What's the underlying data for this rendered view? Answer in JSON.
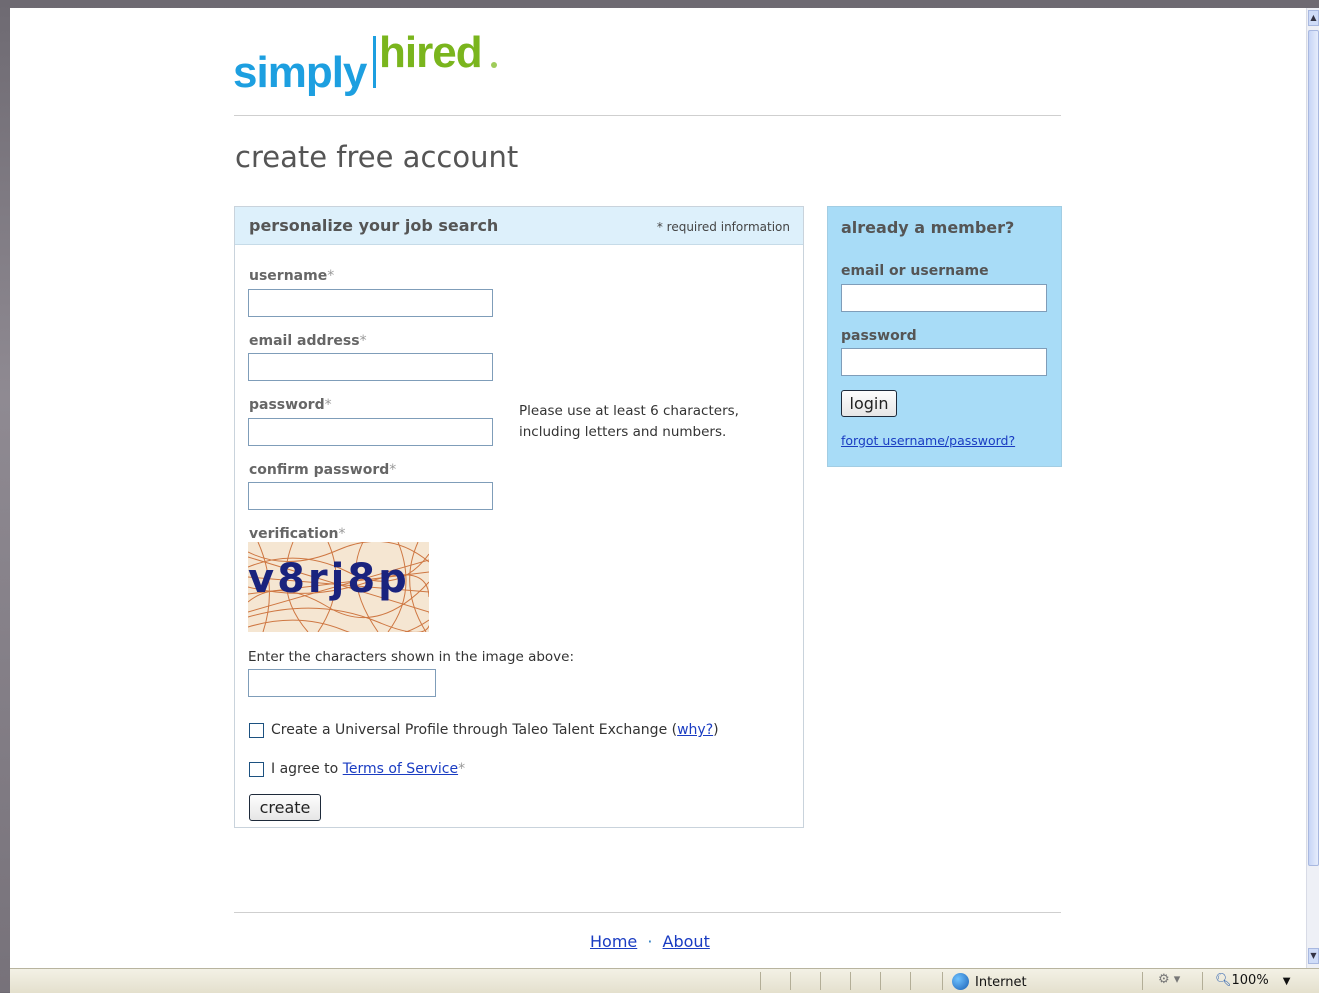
{
  "logo": {
    "part1": "simply",
    "part2": "hired"
  },
  "page_title": "create free account",
  "form": {
    "header_title": "personalize your job search",
    "required_note": "* required information",
    "fields": {
      "username": "username",
      "email": "email address",
      "password": "password",
      "confirm_password": "confirm password",
      "verification": "verification"
    },
    "required_star": "*",
    "password_hint_line1": "Please use at least 6 characters,",
    "password_hint_line2": "including letters and numbers.",
    "captcha_chars": "v8rj8p",
    "captcha_instruction": "Enter the characters shown in the image above:",
    "universal_profile_label": "Create a Universal Profile through Taleo Talent Exchange (",
    "universal_profile_link": "why?",
    "universal_profile_close": ")",
    "agree_label": "I agree to ",
    "terms_link": "Terms of Service",
    "agree_star": "*",
    "create_button": "create"
  },
  "login": {
    "title": "already a member?",
    "user_label": "email or username",
    "password_label": "password",
    "login_button": "login",
    "forgot_link": "forgot username/password?"
  },
  "footer": {
    "home": "Home",
    "separator": "·",
    "about": "About"
  },
  "statusbar": {
    "zone": "Internet",
    "zoom": "100%"
  },
  "colors": {
    "brand_blue": "#1d9fe0",
    "brand_green": "#7ab51d",
    "login_panel": "#a8dcf7",
    "form_header": "#ddf0fb"
  }
}
